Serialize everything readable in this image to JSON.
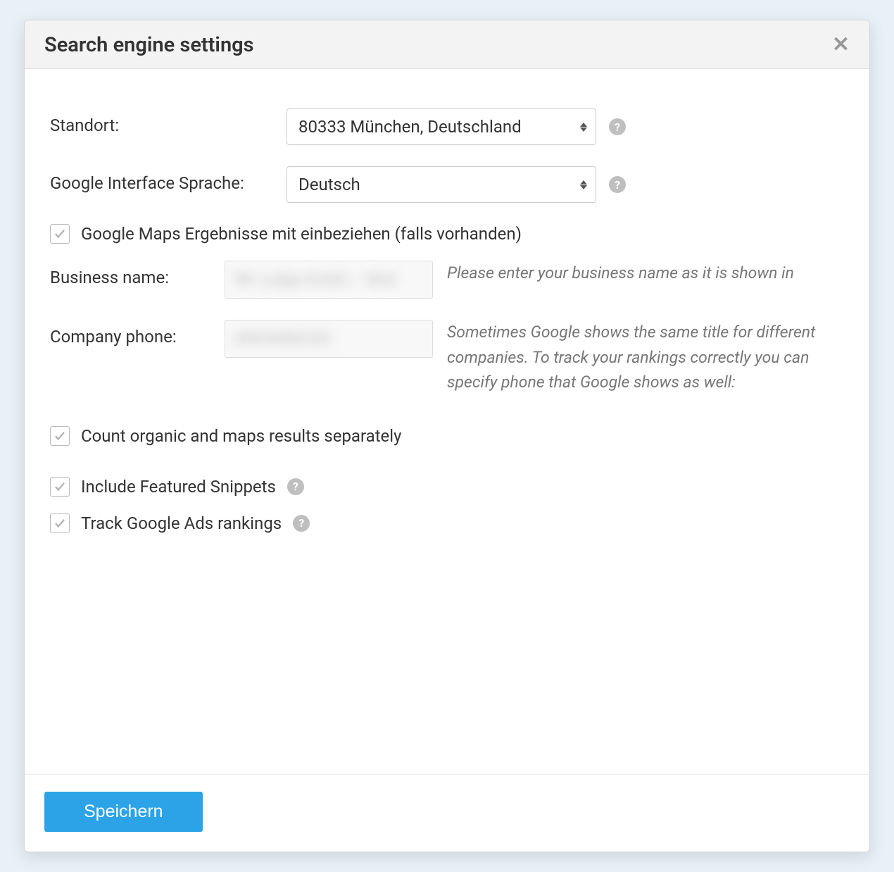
{
  "modal": {
    "title": "Search engine settings"
  },
  "fields": {
    "location_label": "Standort:",
    "location_value": "80333 München, Deutschland",
    "language_label": "Google Interface Sprache:",
    "language_value": "Deutsch",
    "maps_checkbox_label": "Google Maps Ergebnisse mit einbeziehen (falls vorhanden)",
    "business_name_label": "Business name:",
    "business_name_value": "Mr Lodge GmbH – Woh",
    "business_name_hint": "Please enter your business name as it is shown in",
    "company_phone_label": "Company phone:",
    "company_phone_value": "08934082320",
    "company_phone_hint": "Sometimes Google shows the same title for different companies. To track your rankings correctly you can specify phone that Google shows as well:",
    "count_separately_label": "Count organic and maps results separately",
    "featured_snippets_label": "Include Featured Snippets",
    "track_ads_label": "Track Google Ads rankings"
  },
  "footer": {
    "save_label": "Speichern"
  }
}
